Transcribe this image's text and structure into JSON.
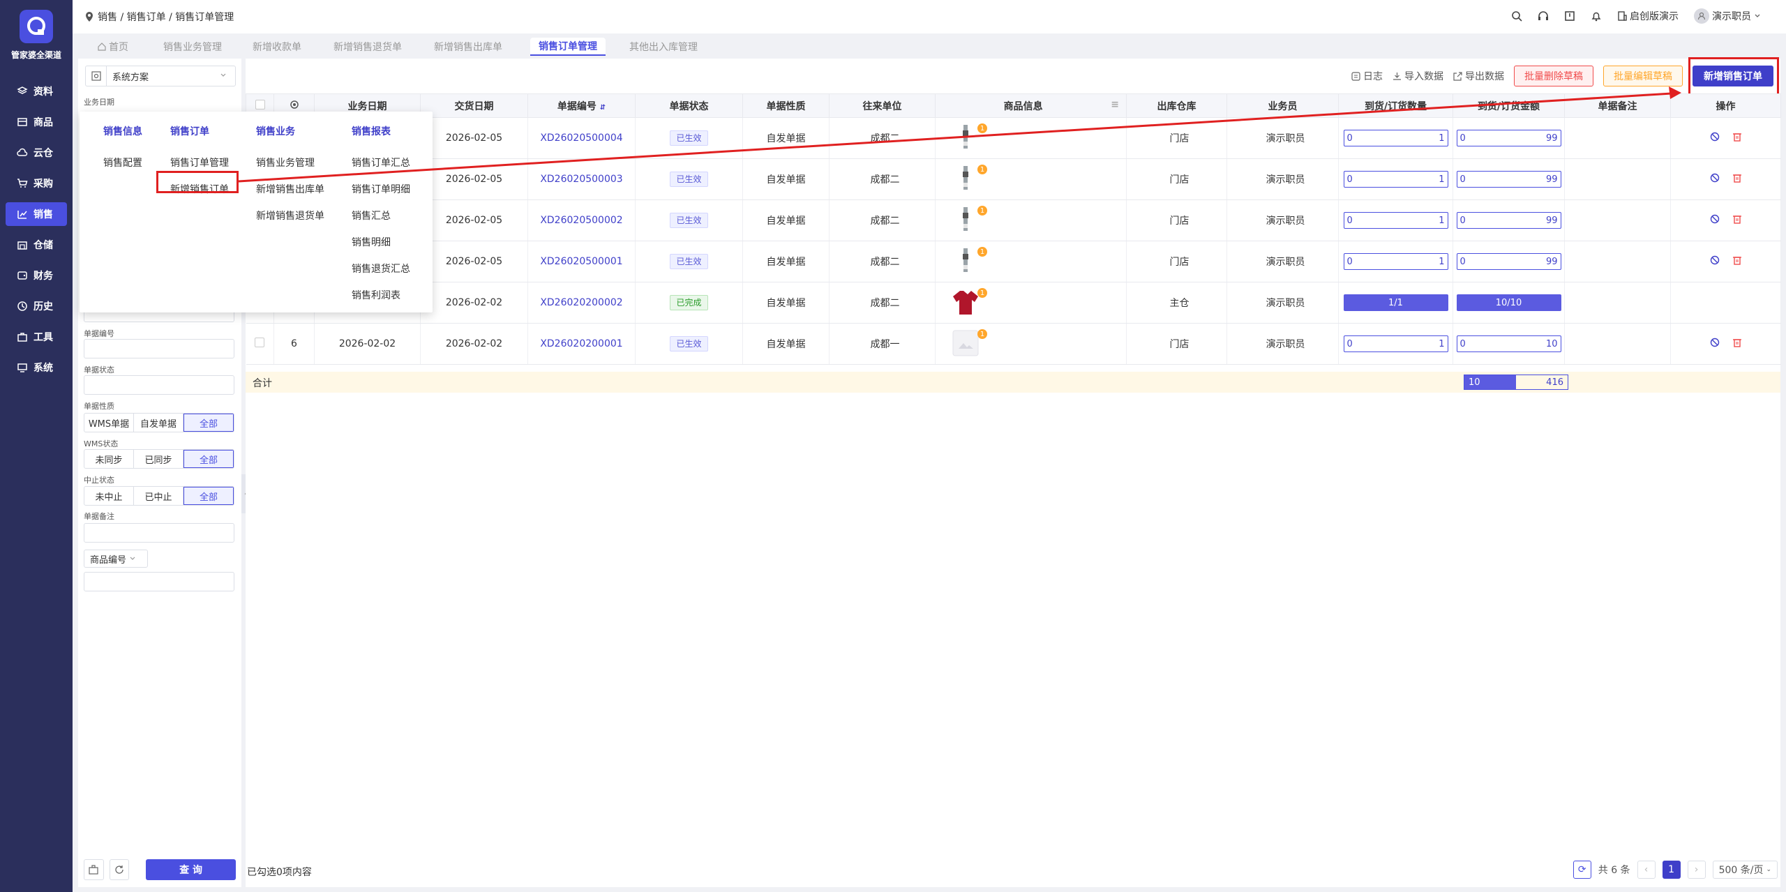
{
  "nav": {
    "brand": "管家婆全渠道",
    "items": [
      {
        "label": "资料",
        "icon": "layers-icon"
      },
      {
        "label": "商品",
        "icon": "box-icon"
      },
      {
        "label": "云仓",
        "icon": "cloud-icon"
      },
      {
        "label": "采购",
        "icon": "cart-icon"
      },
      {
        "label": "销售",
        "icon": "chart-icon",
        "active": true
      },
      {
        "label": "仓储",
        "icon": "warehouse-icon"
      },
      {
        "label": "财务",
        "icon": "wallet-icon"
      },
      {
        "label": "历史",
        "icon": "clock-icon"
      },
      {
        "label": "工具",
        "icon": "toolbox-icon"
      },
      {
        "label": "系统",
        "icon": "monitor-icon"
      }
    ]
  },
  "header": {
    "breadcrumb": "销售 / 销售订单 / 销售订单管理",
    "company": "启创版演示",
    "user": "演示职员"
  },
  "tabs": [
    {
      "label": "首页"
    },
    {
      "label": "销售业务管理"
    },
    {
      "label": "新增收款单"
    },
    {
      "label": "新增销售退货单"
    },
    {
      "label": "新增销售出库单"
    },
    {
      "label": "销售订单管理",
      "active": true
    },
    {
      "label": "其他出入库管理"
    }
  ],
  "filter": {
    "scheme": "系统方案",
    "labels": {
      "biz_date": "业务日期",
      "bill_no": "单据编号",
      "bill_status": "单据状态",
      "bill_nature": "单据性质",
      "wms_status": "WMS状态",
      "stop_status": "中止状态",
      "bill_remark": "单据备注"
    },
    "nature_options": [
      "WMS单据",
      "自发单据",
      "全部"
    ],
    "wms_options": [
      "未同步",
      "已同步",
      "全部"
    ],
    "stop_options": [
      "未中止",
      "已中止",
      "全部"
    ],
    "product_field": "商品编号",
    "query": "查 询"
  },
  "toolbar": {
    "log": "日志",
    "import": "导入数据",
    "export": "导出数据",
    "batch_delete": "批量删除草稿",
    "batch_edit": "批量编辑草稿",
    "new_order": "新增销售订单"
  },
  "table": {
    "headers": [
      "业务日期",
      "交货日期",
      "单据编号",
      "单据状态",
      "单据性质",
      "往来单位",
      "商品信息",
      "出库仓库",
      "业务员",
      "到货/订货数量",
      "到货/订货金额",
      "单据备注",
      "操作"
    ],
    "rows": [
      {
        "no": "",
        "biz_date": "",
        "deliver_date": "2026-02-05",
        "bill_no": "XD26020500004",
        "status": "已生效",
        "nature": "自发单据",
        "partner": "成都二",
        "warehouse": "门店",
        "staff": "演示职员",
        "qty_a": "0",
        "qty_b": "1",
        "amt_a": "0",
        "amt_b": "99",
        "bar": false,
        "img": "tool"
      },
      {
        "no": "",
        "biz_date": "",
        "deliver_date": "2026-02-05",
        "bill_no": "XD26020500003",
        "status": "已生效",
        "nature": "自发单据",
        "partner": "成都二",
        "warehouse": "门店",
        "staff": "演示职员",
        "qty_a": "0",
        "qty_b": "1",
        "amt_a": "0",
        "amt_b": "99",
        "bar": false,
        "img": "tool"
      },
      {
        "no": "",
        "biz_date": "",
        "deliver_date": "2026-02-05",
        "bill_no": "XD26020500002",
        "status": "已生效",
        "nature": "自发单据",
        "partner": "成都二",
        "warehouse": "门店",
        "staff": "演示职员",
        "qty_a": "0",
        "qty_b": "1",
        "amt_a": "0",
        "amt_b": "99",
        "bar": false,
        "img": "tool"
      },
      {
        "no": "",
        "biz_date": "",
        "deliver_date": "2026-02-05",
        "bill_no": "XD26020500001",
        "status": "已生效",
        "nature": "自发单据",
        "partner": "成都二",
        "warehouse": "门店",
        "staff": "演示职员",
        "qty_a": "0",
        "qty_b": "1",
        "amt_a": "0",
        "amt_b": "99",
        "bar": false,
        "img": "tool"
      },
      {
        "no": "",
        "biz_date": "",
        "deliver_date": "2026-02-02",
        "bill_no": "XD26020200002",
        "status": "已完成",
        "nature": "自发单据",
        "partner": "成都二",
        "warehouse": "主仓",
        "staff": "演示职员",
        "qty_text": "1/1",
        "amt_text": "10/10",
        "bar": true,
        "img": "shirt"
      },
      {
        "no": "6",
        "biz_date": "2026-02-02",
        "deliver_date": "2026-02-02",
        "bill_no": "XD26020200001",
        "status": "已生效",
        "nature": "自发单据",
        "partner": "成都一",
        "warehouse": "门店",
        "staff": "演示职员",
        "qty_a": "0",
        "qty_b": "1",
        "amt_a": "0",
        "amt_b": "10",
        "bar": false,
        "img": "blank"
      }
    ],
    "product_badge": "1",
    "sum_label": "合计",
    "sum_a": "10",
    "sum_b": "416"
  },
  "menu": {
    "columns": [
      {
        "head": "销售信息",
        "items": [
          "销售配置"
        ]
      },
      {
        "head": "销售订单",
        "items": [
          "销售订单管理",
          "新增销售订单"
        ]
      },
      {
        "head": "销售业务",
        "items": [
          "销售业务管理",
          "新增销售出库单",
          "新增销售退货单"
        ]
      },
      {
        "head": "销售报表",
        "items": [
          "销售订单汇总",
          "销售订单明细",
          "销售汇总",
          "销售明细",
          "销售退货汇总",
          "销售利润表"
        ]
      }
    ]
  },
  "footer": {
    "selected": "已勾选0项内容",
    "total": "共 6 条",
    "page": "1",
    "page_size": "500 条/页"
  },
  "colors": {
    "accent": "#3f3fc9",
    "nav_bg": "#2b2f5c",
    "highlight": "#e02020"
  }
}
